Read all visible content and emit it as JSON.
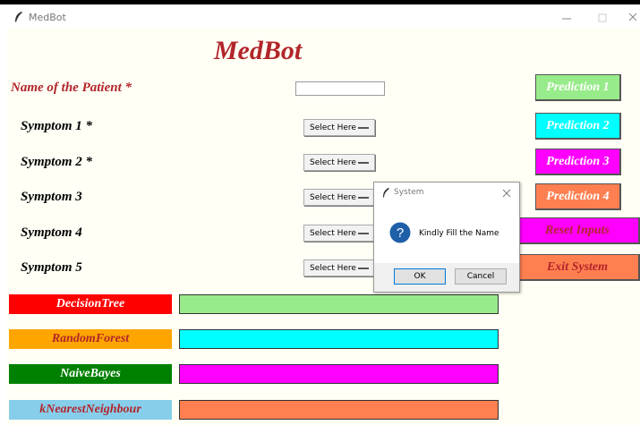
{
  "window": {
    "title": "MedBot",
    "icon": "feather-icon",
    "controls": [
      "minimize-icon",
      "maximize-icon",
      "close-icon"
    ]
  },
  "app": {
    "title": "MedBot",
    "patient_label": "Name of the Patient *",
    "patient_name_value": ""
  },
  "symptoms": [
    {
      "label": "Symptom 1 *",
      "value": "Select Here"
    },
    {
      "label": "Symptom 2 *",
      "value": "Select Here"
    },
    {
      "label": "Symptom 3",
      "value": "Select Here"
    },
    {
      "label": "Symptom 4",
      "value": "Select Here"
    },
    {
      "label": "Symptom 5",
      "value": "Select Here"
    }
  ],
  "buttons": {
    "prediction1": "Prediction 1",
    "prediction2": "Prediction 2",
    "prediction3": "Prediction 3",
    "prediction4": "Prediction 4",
    "reset": "Reset Inputs",
    "exit": "Exit System"
  },
  "algorithms": [
    {
      "label": "DecisionTree",
      "label_bg": "#ff0000",
      "label_color": "#ffffff",
      "result_bg": "#98eb8a",
      "result": ""
    },
    {
      "label": "RandomForest",
      "label_bg": "#ffa500",
      "label_color": "#b2252a",
      "result_bg": "#00ffff",
      "result": ""
    },
    {
      "label": "NaiveBayes",
      "label_bg": "#008000",
      "label_color": "#ffffff",
      "result_bg": "#ff00ff",
      "result": ""
    },
    {
      "label": "kNearestNeighbour",
      "label_bg": "#87ceeb",
      "label_color": "#b2252a",
      "result_bg": "#ff7f50",
      "result": ""
    }
  ],
  "colors": {
    "title_red": "#b2252a",
    "prediction1_bg": "#98eb8a",
    "prediction2_bg": "#00ffff",
    "prediction3_bg": "#ff00ff",
    "prediction4_bg": "#ff7f50",
    "reset_bg": "#ff00ff",
    "reset_fg": "#b2252a",
    "exit_bg": "#ff7f50",
    "exit_fg": "#b2252a"
  },
  "dialog": {
    "title": "System",
    "icon": "question-icon",
    "message": "Kindly Fill the Name",
    "ok_label": "OK",
    "cancel_label": "Cancel"
  }
}
